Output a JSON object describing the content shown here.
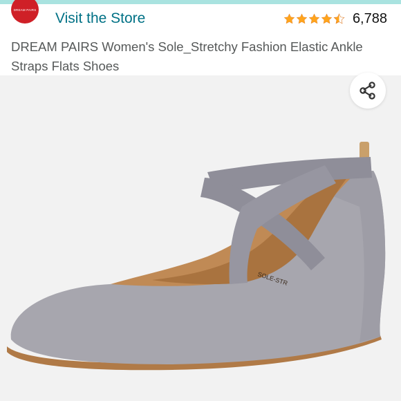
{
  "store": {
    "logo_text": "DREAM PAIRS",
    "link_label": "Visit the Store",
    "link_color": "#007185"
  },
  "rating": {
    "stars": 4.5,
    "count": "6,788",
    "star_color": "#ffa41c"
  },
  "product": {
    "title": "DREAM PAIRS Women's Sole_Stretchy Fashion Elastic Ankle Straps Flats Shoes",
    "insole_text": "SOLE-STR",
    "shoe_color": "#a7a6ae",
    "strap_color": "#8f8e99"
  },
  "actions": {
    "share_icon": "share-icon"
  }
}
